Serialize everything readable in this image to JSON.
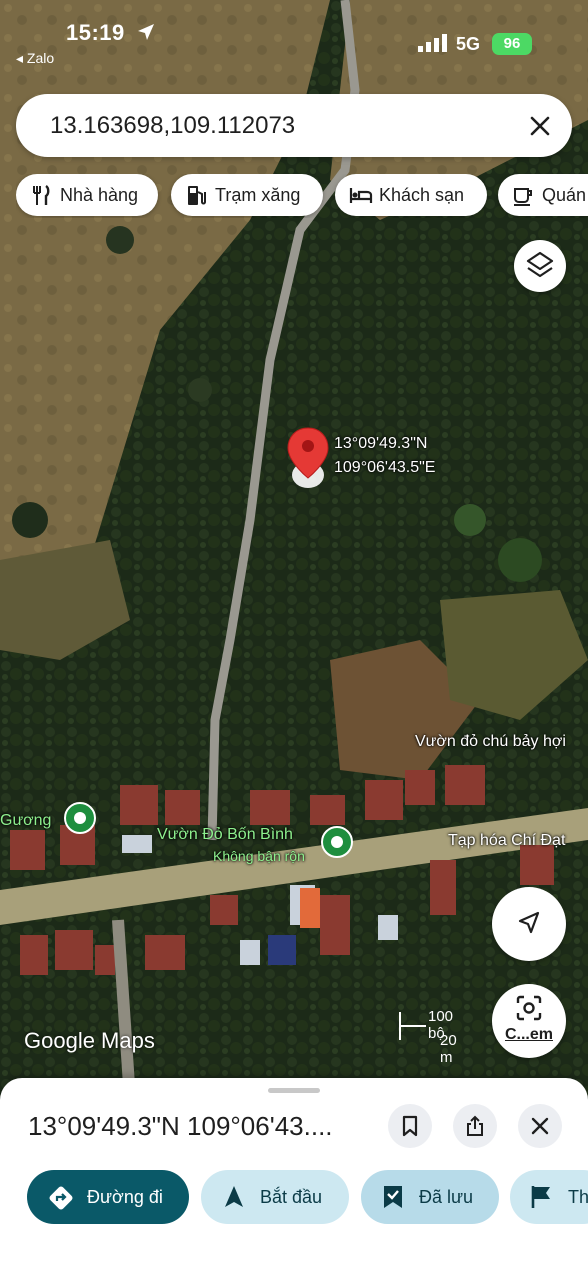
{
  "status_bar": {
    "time": "15:19",
    "back_app": "◂ Zalo",
    "network": "5G",
    "battery": "96"
  },
  "search": {
    "value": "13.163698,109.112073"
  },
  "chips": [
    {
      "label": "Nhà hàng",
      "icon": "fork-knife-icon"
    },
    {
      "label": "Trạm xăng",
      "icon": "fuel-pump-icon"
    },
    {
      "label": "Khách sạn",
      "icon": "bed-icon"
    },
    {
      "label": "Quán",
      "icon": "coffee-cup-icon"
    }
  ],
  "map": {
    "pin": {
      "lat_label": "13°09'49.3\"N",
      "lng_label": "109°06'43.5\"E"
    },
    "pois": [
      {
        "label": "Vườn đỏ chú bảy hợi"
      },
      {
        "label": "Gương"
      },
      {
        "label": "Vườn Đỏ Bốn Bình"
      },
      {
        "label": "Không bận rộn"
      },
      {
        "label": "Tạp hóa Chí Đạt"
      }
    ],
    "scale": {
      "imperial": "100 bộ",
      "metric": "20 m"
    },
    "logo": "Google Maps",
    "lens_label": "C...em"
  },
  "sheet": {
    "title": "13°09'49.3\"N 109°06'43....",
    "actions": [
      {
        "label": "Đường đi",
        "icon": "directions-icon"
      },
      {
        "label": "Bắt đầu",
        "icon": "navigation-arrow-icon"
      },
      {
        "label": "Đã lưu",
        "icon": "bookmark-check-icon"
      },
      {
        "label": "Th",
        "icon": "flag-icon"
      }
    ]
  },
  "colors": {
    "accent": "#0a5968",
    "chip_bg": "#cde8f1",
    "pin": "#e53935"
  }
}
